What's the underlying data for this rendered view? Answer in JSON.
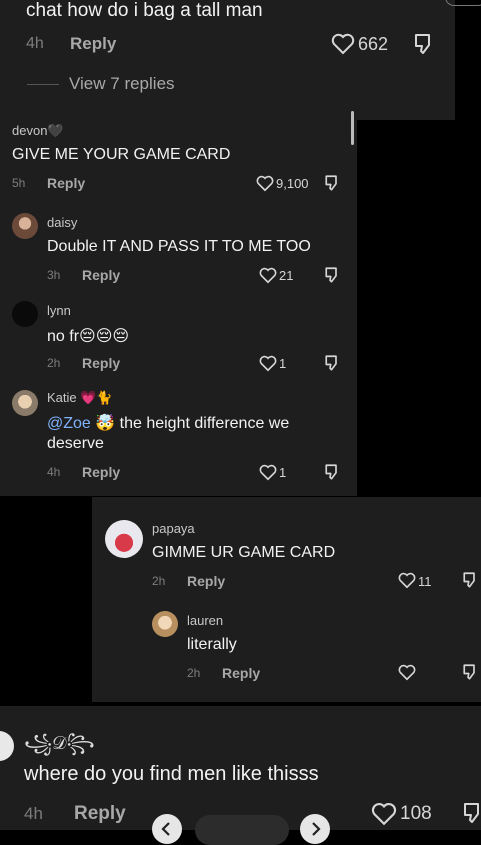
{
  "top_comment": {
    "body": "chat how do i bag a tall man",
    "time": "4h",
    "reply": "Reply",
    "likes": "662",
    "view_replies": "View 7 replies"
  },
  "thread": [
    {
      "user": "devon🖤",
      "body": "GIVE ME YOUR GAME CARD",
      "time": "5h",
      "reply": "Reply",
      "likes": "9,100"
    },
    {
      "user": "daisy",
      "body": "Double IT AND PASS IT TO ME TOO",
      "time": "3h",
      "reply": "Reply",
      "likes": "21"
    },
    {
      "user": "lynn",
      "body": "no fr😔😔😔",
      "time": "2h",
      "reply": "Reply",
      "likes": "1"
    },
    {
      "user": "Katie 💗🐈",
      "mention": "@Zoe",
      "mention_emoji": "🤯",
      "body": " the height difference we",
      "body2": "deserve",
      "time": "4h",
      "reply": "Reply",
      "likes": "1"
    }
  ],
  "papaya": {
    "user": "papaya",
    "body": "GIMME UR GAME CARD",
    "time": "2h",
    "reply": "Reply",
    "likes": "11"
  },
  "lauren": {
    "user": "lauren",
    "body": "literally",
    "time": "2h",
    "reply": "Reply",
    "likes": ""
  },
  "bottom_comment": {
    "user": "꧁𝒟꧂",
    "body": "where do you find men like thisss",
    "time": "4h",
    "reply": "Reply",
    "likes": "108"
  },
  "colors": {
    "panel": "#1e1e1e",
    "mention": "#7fb3ff",
    "background": "#000000"
  }
}
